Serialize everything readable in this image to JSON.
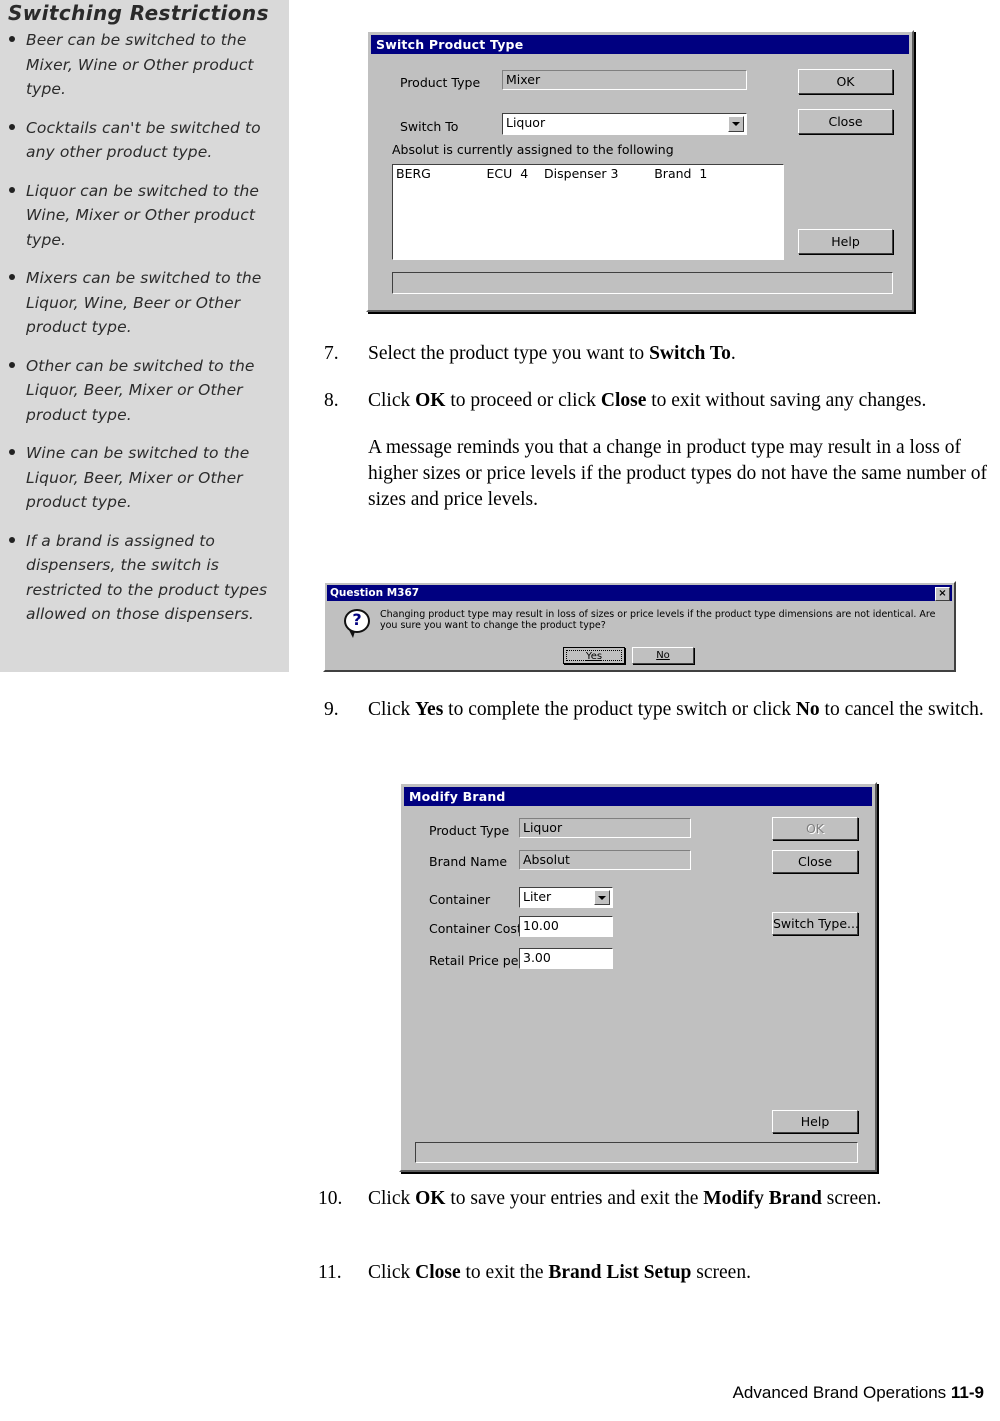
{
  "sidebar": {
    "title": "Switching Restrictions",
    "items": [
      "Beer can be switched to the Mixer, Wine or Other product type.",
      "Cocktails can't be switched to any other product type.",
      "Liquor can be switched to the Wine, Mixer or Other product type.",
      "Mixers can be switched to the Liquor, Wine, Beer or Other product type.",
      "Other can be switched to the Liquor, Beer, Mixer or Other product type.",
      "Wine can be switched to the Liquor, Beer, Mixer or Other product type.",
      "If a brand is assigned to dispensers, the switch is restricted to the product types allowed on those dispensers."
    ]
  },
  "switch_dialog": {
    "title": "Switch Product Type",
    "product_type_label": "Product Type",
    "product_type_value": "Mixer",
    "switch_to_label": "Switch To",
    "switch_to_value": "Liquor",
    "assigned_text": "Absolut is currently assigned to the following",
    "list_rows": [
      "BERG              ECU  4    Dispenser 3         Brand  1"
    ],
    "ok_label": "OK",
    "close_label": "Close",
    "help_label": "Help"
  },
  "steps": {
    "s7_num": "7.",
    "s7_a": "Select the product type you want to ",
    "s7_b": "Switch To",
    "s7_c": ".",
    "s8_num": "8.",
    "s8_a": "Click ",
    "s8_b": "OK",
    "s8_c": " to proceed or click ",
    "s8_d": "Close",
    "s8_e": " to exit without saving any changes.",
    "s8_p2": "A message reminds you that a change in product type may result in a loss of higher sizes or price levels if the product types do not have the same number of sizes and price levels.",
    "s9_num": "9.",
    "s9_a": "Click ",
    "s9_b": "Yes",
    "s9_c": " to complete the product type switch or click ",
    "s9_d": "No",
    "s9_e": " to cancel the switch.",
    "s10_num": "10.",
    "s10_a": "Click ",
    "s10_b": "OK",
    "s10_c": " to save your entries and exit the ",
    "s10_d": "Modify Brand",
    "s10_e": " screen.",
    "s11_num": "11.",
    "s11_a": "Click ",
    "s11_b": "Close",
    "s11_c": " to exit the ",
    "s11_d": "Brand List Setup",
    "s11_e": " screen."
  },
  "message_box": {
    "title": "Question M367",
    "close_glyph": "×",
    "icon": "question-icon",
    "icon_glyph": "?",
    "text": "Changing product type may result in loss of sizes or price levels if the product type dimensions are not identical. Are you sure you want to change the product type?",
    "yes_label": "Yes",
    "no_label": "No"
  },
  "modify_dialog": {
    "title": "Modify Brand",
    "product_type_label": "Product Type",
    "product_type_value": "Liquor",
    "brand_name_label": "Brand Name",
    "brand_name_value": "Absolut",
    "container_label": "Container",
    "container_value": "Liter",
    "container_cost_label": "Container Cost",
    "container_cost_value": "10.00",
    "retail_price_label": "Retail Price per oz",
    "retail_price_value": "3.00",
    "ok_label": "OK",
    "close_label": "Close",
    "switch_type_label": "Switch Type...",
    "help_label": "Help"
  },
  "footer": {
    "chapter": "Advanced Brand Operations",
    "page": "11-9"
  },
  "colors": {
    "titlebar": "#000080",
    "dialog_face": "#c0c0c0",
    "sidebar_bg": "#d9d9d9"
  }
}
